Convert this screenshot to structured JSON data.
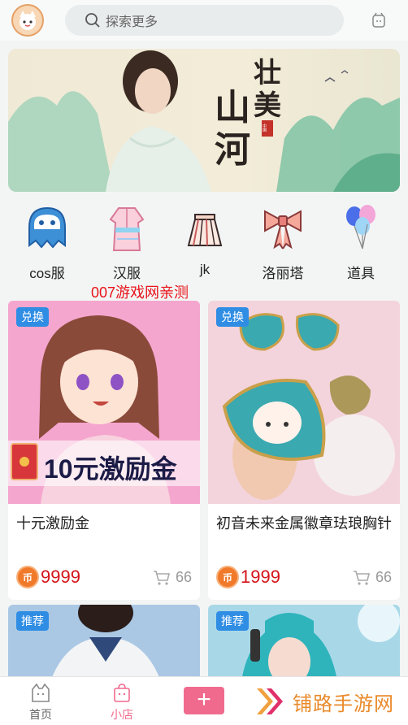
{
  "header": {
    "search_placeholder": "探索更多"
  },
  "banner": {
    "title_chars": [
      "壮",
      "美",
      "山",
      "河"
    ],
    "seal": "中国"
  },
  "categories": [
    {
      "label": "cos服",
      "icon": "ghost-icon"
    },
    {
      "label": "汉服",
      "icon": "hanfu-dress-icon"
    },
    {
      "label": "jk",
      "icon": "pleated-skirt-icon"
    },
    {
      "label": "洛丽塔",
      "icon": "bow-icon"
    },
    {
      "label": "道具",
      "icon": "balloons-icon"
    }
  ],
  "watermark": "007游戏网亲测",
  "products": [
    {
      "tag": "兑换",
      "title": "十元激励金",
      "price": "9999",
      "sold": "66",
      "overlay_text": "10元激励金",
      "coin_label": "币"
    },
    {
      "tag": "兑换",
      "title": "初音未来金属徽章珐琅胸针",
      "price": "1999",
      "sold": "66",
      "coin_label": "币"
    },
    {
      "tag": "推荐",
      "title": "",
      "price": "",
      "sold": ""
    },
    {
      "tag": "推荐",
      "title": "",
      "price": "",
      "sold": ""
    }
  ],
  "tabbar": {
    "home_label": "首页",
    "shop_label": "小店",
    "plus_label": "+",
    "brand_label": "铺路手游网"
  },
  "colors": {
    "accent_pink": "#f06a8e",
    "tag_blue": "#2f8de4",
    "price_red": "#d4141a",
    "coin_orange": "#f07a2a",
    "watermark_red": "#e8141a"
  }
}
